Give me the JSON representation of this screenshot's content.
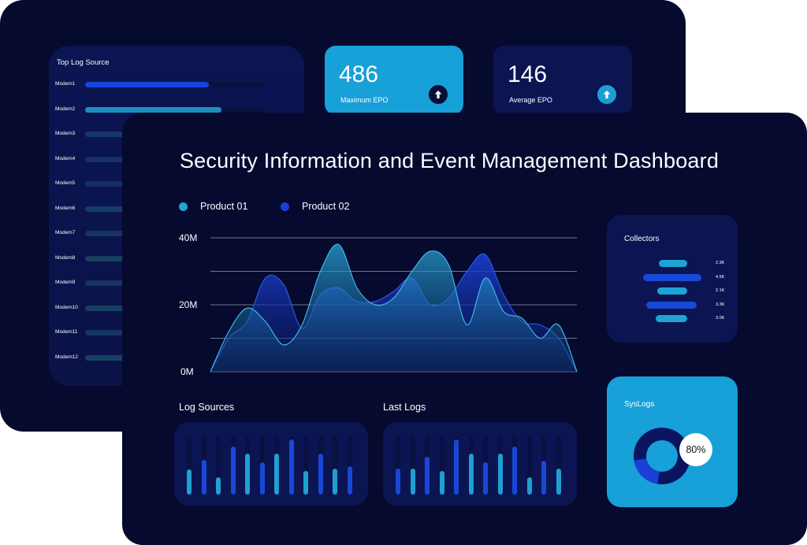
{
  "back": {
    "top_log_source": {
      "title": "Top Log Source",
      "rows": [
        {
          "label": "Modem1",
          "fill": 0.69,
          "color": "#1546d9"
        },
        {
          "label": "Modem2",
          "fill": 0.76,
          "color": "#1d8fbf"
        },
        {
          "label": "Modem3",
          "fill": 0.5,
          "color": "#17356f"
        },
        {
          "label": "Modem4",
          "fill": 0.46,
          "color": "#16325f"
        },
        {
          "label": "Modem5",
          "fill": 0.45,
          "color": "#152f63"
        },
        {
          "label": "Modem6",
          "fill": 0.48,
          "color": "#163b66"
        },
        {
          "label": "Modem7",
          "fill": 0.45,
          "color": "#163460"
        },
        {
          "label": "Modem8",
          "fill": 0.47,
          "color": "#17405f"
        },
        {
          "label": "Modem9",
          "fill": 0.45,
          "color": "#163460"
        },
        {
          "label": "Modem10",
          "fill": 0.46,
          "color": "#16405f"
        },
        {
          "label": "Modem11",
          "fill": 0.45,
          "color": "#163460"
        },
        {
          "label": "Modem12",
          "fill": 0.47,
          "color": "#17405f"
        }
      ]
    },
    "stats": [
      {
        "value": "486",
        "label": "Maximum EPO",
        "card_color": "#18a0d8",
        "arrow_bg": "#061035",
        "icon": "arrow-up-icon"
      },
      {
        "value": "146",
        "label": "Average EPO",
        "card_color": "#0b1552",
        "arrow_bg": "#1c9fd3",
        "icon": "arrow-up-icon"
      }
    ]
  },
  "front": {
    "title": "Security Information and Event Management Dashboard",
    "legend": [
      {
        "name": "Product 01",
        "color": "#1ea4d6"
      },
      {
        "name": "Product 02",
        "color": "#1a3fd6"
      }
    ],
    "y_ticks": [
      "40M",
      "20M",
      "0M"
    ],
    "log_sources": {
      "title": "Log Sources",
      "bars": [
        {
          "fill": 0.43,
          "color": "#1f9fd2"
        },
        {
          "fill": 0.6,
          "color": "#1947d6"
        },
        {
          "fill": 0.3,
          "color": "#1f9fd2"
        },
        {
          "fill": 0.82,
          "color": "#1947d6"
        },
        {
          "fill": 0.7,
          "color": "#1f9fd2"
        },
        {
          "fill": 0.55,
          "color": "#1947d6"
        },
        {
          "fill": 0.7,
          "color": "#1f9fd2"
        },
        {
          "fill": 0.95,
          "color": "#1947d6"
        },
        {
          "fill": 0.4,
          "color": "#1f9fd2"
        },
        {
          "fill": 0.7,
          "color": "#1947d6"
        },
        {
          "fill": 0.45,
          "color": "#1f9fd2"
        },
        {
          "fill": 0.48,
          "color": "#1947d6"
        }
      ]
    },
    "last_logs": {
      "title": "Last Logs",
      "bars": [
        {
          "fill": 0.45,
          "color": "#1947d6"
        },
        {
          "fill": 0.45,
          "color": "#1f9fd2"
        },
        {
          "fill": 0.65,
          "color": "#1947d6"
        },
        {
          "fill": 0.4,
          "color": "#1f9fd2"
        },
        {
          "fill": 0.95,
          "color": "#1947d6"
        },
        {
          "fill": 0.7,
          "color": "#1f9fd2"
        },
        {
          "fill": 0.55,
          "color": "#1947d6"
        },
        {
          "fill": 0.7,
          "color": "#1f9fd2"
        },
        {
          "fill": 0.82,
          "color": "#1947d6"
        },
        {
          "fill": 0.3,
          "color": "#1f9fd2"
        },
        {
          "fill": 0.58,
          "color": "#1947d6"
        },
        {
          "fill": 0.45,
          "color": "#1f9fd2"
        }
      ]
    },
    "collectors": {
      "title": "Collectors",
      "rows": [
        {
          "value": "2.3K",
          "color": "#1fa3d6"
        },
        {
          "value": "4.5K",
          "color": "#1947d6"
        },
        {
          "value": "2.1K",
          "color": "#1fa3d6"
        },
        {
          "value": "3.3K",
          "color": "#1947d6"
        },
        {
          "value": "3.0K",
          "color": "#1fa3d6"
        }
      ]
    },
    "syslogs": {
      "title": "SysLogs",
      "percent": "80%",
      "fraction": 0.8
    }
  },
  "chart_data": {
    "type": "area",
    "x": [
      0,
      1,
      2,
      3,
      4,
      5,
      6,
      7,
      8,
      9,
      10,
      11,
      12,
      13,
      14,
      15,
      16,
      17,
      18,
      19,
      20
    ],
    "ylim": [
      0,
      40
    ],
    "yticks": [
      "40M",
      "20M",
      "0M"
    ],
    "series": [
      {
        "name": "Product 01",
        "values": [
          0,
          12,
          19,
          15,
          8,
          14,
          30,
          38,
          25,
          20,
          22,
          30,
          36,
          32,
          14,
          28,
          18,
          16,
          10,
          14,
          0
        ]
      },
      {
        "name": "Product 02",
        "values": [
          0,
          10,
          15,
          28,
          26,
          13,
          23,
          25,
          21,
          21,
          24,
          28,
          20,
          22,
          30,
          35,
          23,
          15,
          14,
          10,
          0
        ]
      }
    ]
  }
}
